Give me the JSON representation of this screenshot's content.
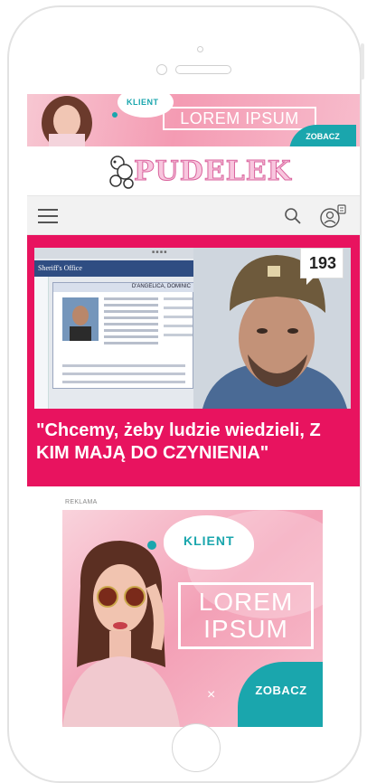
{
  "top_banner": {
    "klient": "KLIENT",
    "lorem": "LOREM IPSUM",
    "zobacz": "ZOBACZ"
  },
  "logo": {
    "text": "PUDELEK"
  },
  "article": {
    "comments_count": "193",
    "image_panel_title": "Sheriff's Office",
    "record_name": "D'ANGELICA, DOMINIC",
    "headline": "\"Chcemy, żeby ludzie wiedzieli, Z KIM MAJĄ DO CZYNIENIA\""
  },
  "ad": {
    "label": "REKLAMA",
    "klient": "KLIENT",
    "lorem_line1": "LOREM",
    "lorem_line2": "IPSUM",
    "zobacz": "ZOBACZ",
    "close": "×"
  },
  "colors": {
    "brand_pink": "#e8135f",
    "teal": "#1aa6ad"
  }
}
